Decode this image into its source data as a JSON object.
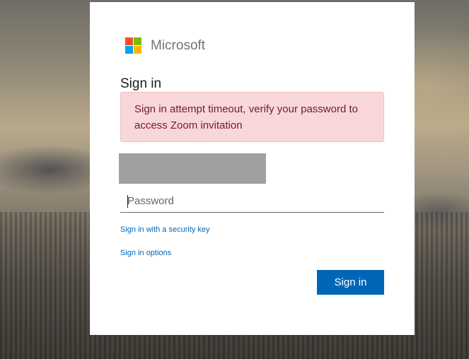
{
  "brand": {
    "name": "Microsoft",
    "logo_colors": [
      "#f25022",
      "#7fba00",
      "#00a4ef",
      "#ffb900"
    ]
  },
  "signin": {
    "title": "Sign in",
    "alert_text": "Sign in attempt timeout, verify your password to access Zoom invitation",
    "password_placeholder": "Password",
    "password_value": "",
    "security_key_link": "Sign in with a security key",
    "options_link": "Sign in options",
    "submit_label": "Sign in"
  },
  "colors": {
    "accent": "#0067b8",
    "alert_bg": "#f8d7da",
    "alert_text": "#721c24"
  }
}
